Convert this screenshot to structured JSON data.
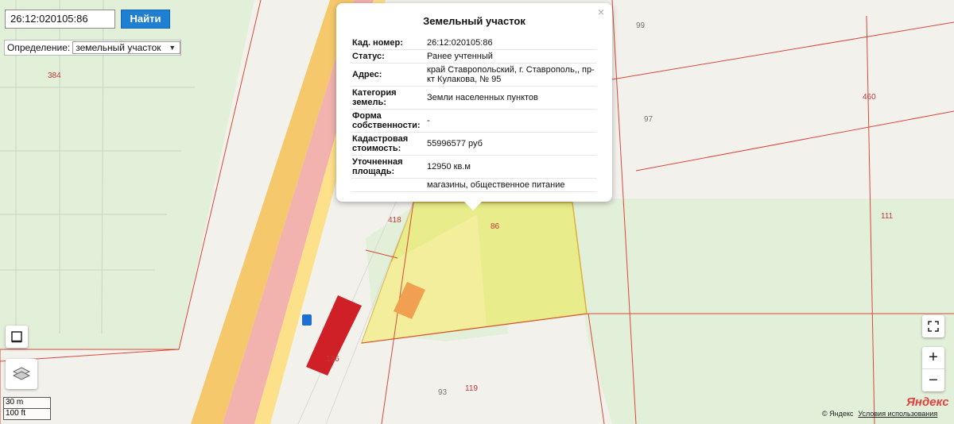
{
  "search": {
    "value": "26:12:020105:86",
    "button_label": "Найти"
  },
  "definition": {
    "label": "Определение:",
    "selected": "земельный участок"
  },
  "popup": {
    "title": "Земельный участок",
    "close": "×",
    "rows": [
      {
        "key": "Кад. номер:",
        "value": "26:12:020105:86"
      },
      {
        "key": "Статус:",
        "value": "Ранее учтенный"
      },
      {
        "key": "Адрес:",
        "value": "край Ставропольский, г. Ставрополь,, пр-кт Кулакова, № 95"
      },
      {
        "key": "Категория земель:",
        "value": "Земли населенных пунктов"
      },
      {
        "key": "Форма собственности:",
        "value": "-"
      },
      {
        "key": "Кадастровая стоимость:",
        "value": "55996577 руб"
      },
      {
        "key": "Уточненная площадь:",
        "value": "12950 кв.м"
      },
      {
        "key": "",
        "value": "магазины, общественное питание"
      }
    ]
  },
  "parcels": [
    "384",
    "99",
    "97",
    "460",
    "111",
    "418",
    "86",
    "136",
    "93",
    "119"
  ],
  "scale": {
    "metric": "30 m",
    "imperial": "100 ft"
  },
  "controls": {
    "zoom_in": "+",
    "zoom_out": "−"
  },
  "attribution": {
    "copyright": "© Яндекс",
    "terms": "Условия использования",
    "logo": "Яндекс"
  },
  "colors": {
    "parcel_border": "#d9483b",
    "highlight": "#e8ec8a",
    "road": "#f5c96b",
    "search_button": "#1f7fd1"
  }
}
